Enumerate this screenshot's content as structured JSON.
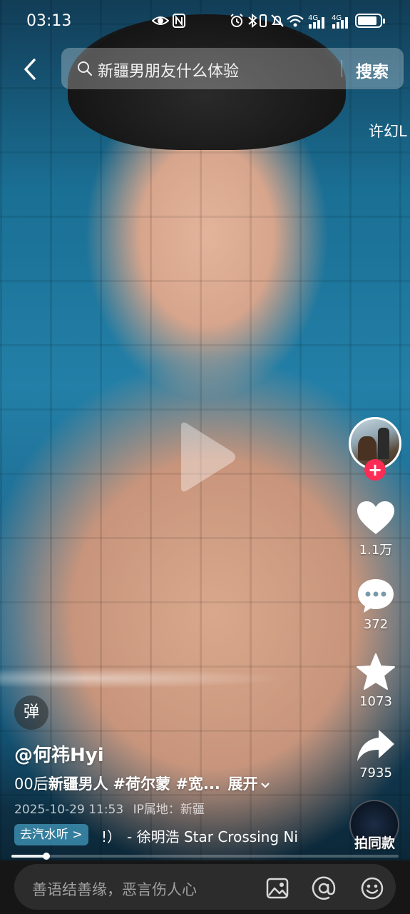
{
  "status_bar": {
    "time": "03:13",
    "network_labels": [
      "4G",
      "4G"
    ]
  },
  "search": {
    "query": "新疆男朋友什么体验",
    "button_label": "搜索"
  },
  "side_tag": "许幻L",
  "actions": {
    "like_count": "1.1万",
    "comment_count": "372",
    "favorite_count": "1073",
    "share_count": "7935"
  },
  "follow_symbol": "+",
  "danmaku_label": "弹",
  "post": {
    "author": "@何祎Hyi",
    "caption_prefix": "00后",
    "caption_highlight": "新疆男人",
    "caption_tags": "#荷尔蒙 #宽...",
    "expand_label": "展开",
    "date": "2025-10-29 11:53",
    "ip_location": "IP属地：新疆"
  },
  "music": {
    "chip_label": "去汽水听 >",
    "partial": "!）",
    "title": "- 徐明浩    Star Crossing Ni"
  },
  "remix_label": "拍同款",
  "progress": 0.09,
  "comment": {
    "placeholder": "善语结善缘，恶言伤人心"
  },
  "colors": {
    "accent": "#fe2c55",
    "comment_bar": "#161616"
  },
  "icons": [
    "eye-icon",
    "nfc-icon",
    "alarm-icon",
    "bluetooth-icon",
    "vibrate-icon",
    "mute-icon",
    "wifi-icon",
    "signal-icon",
    "battery-icon",
    "back-icon",
    "search-icon",
    "play-icon",
    "heart-icon",
    "comment-icon",
    "star-icon",
    "share-icon",
    "image-icon",
    "at-icon",
    "emoji-icon"
  ]
}
